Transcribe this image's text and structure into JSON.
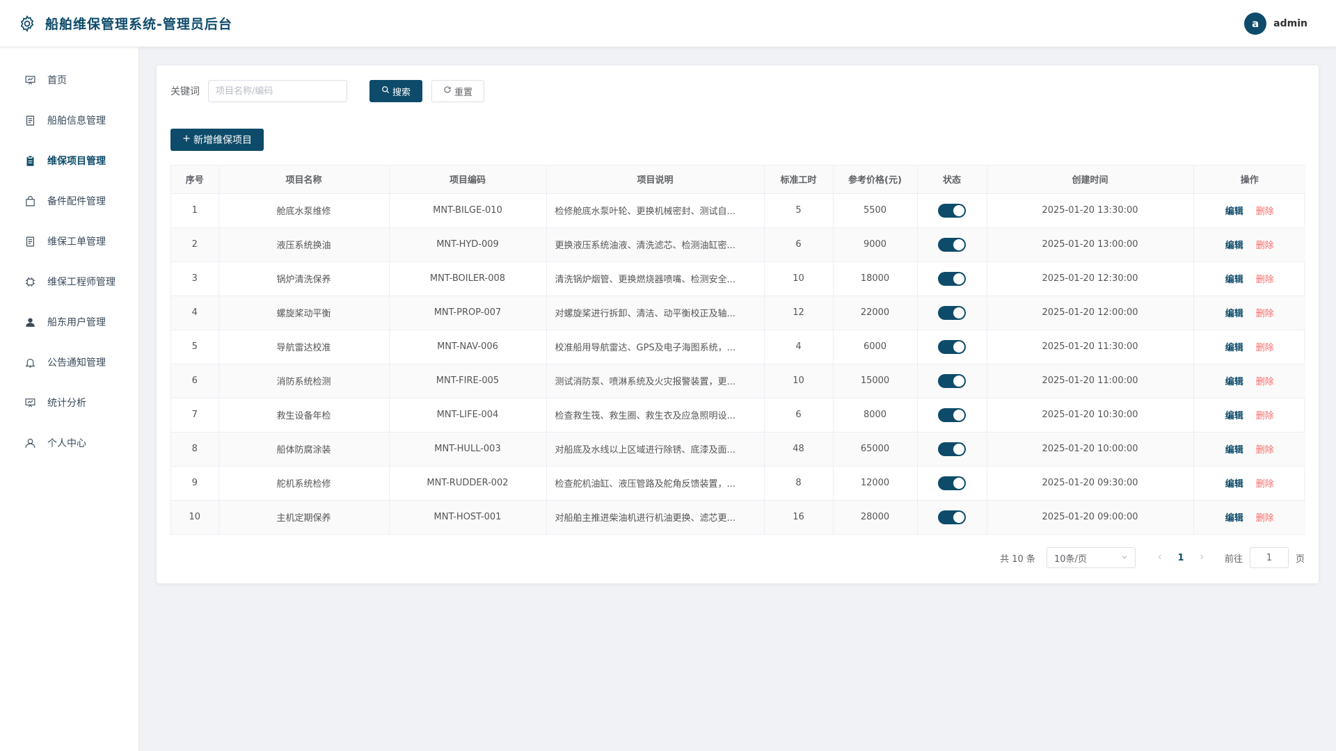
{
  "header": {
    "title": "船舶维保管理系统-管理员后台",
    "avatar_letter": "a",
    "username": "admin"
  },
  "sidebar": {
    "items": [
      {
        "label": "首页",
        "icon": "presentation-icon"
      },
      {
        "label": "船舶信息管理",
        "icon": "document-icon"
      },
      {
        "label": "维保项目管理",
        "icon": "clipboard-icon",
        "active": true
      },
      {
        "label": "备件配件管理",
        "icon": "bag-icon"
      },
      {
        "label": "维保工单管理",
        "icon": "document-icon"
      },
      {
        "label": "维保工程师管理",
        "icon": "cpu-icon"
      },
      {
        "label": "船东用户管理",
        "icon": "user-filled-icon"
      },
      {
        "label": "公告通知管理",
        "icon": "bell-icon"
      },
      {
        "label": "统计分析",
        "icon": "presentation-icon"
      },
      {
        "label": "个人中心",
        "icon": "user-icon"
      }
    ]
  },
  "search": {
    "label": "关键词",
    "placeholder": "项目名称/编码",
    "value": "",
    "search_label": "搜索",
    "reset_label": "重置"
  },
  "toolbar": {
    "add_label": "新增维保项目"
  },
  "table": {
    "columns": [
      "序号",
      "项目名称",
      "项目编码",
      "项目说明",
      "标准工时",
      "参考价格(元)",
      "状态",
      "创建时间",
      "操作"
    ],
    "edit_label": "编辑",
    "delete_label": "删除",
    "rows": [
      {
        "idx": "1",
        "name": "舱底水泵维修",
        "code": "MNT-BILGE-010",
        "desc": "检修舱底水泵叶轮、更换机械密封、测试自...",
        "hours": "5",
        "price": "5500",
        "enabled": true,
        "created": "2025-01-20 13:30:00"
      },
      {
        "idx": "2",
        "name": "液压系统换油",
        "code": "MNT-HYD-009",
        "desc": "更换液压系统油液、清洗滤芯、检测油缸密...",
        "hours": "6",
        "price": "9000",
        "enabled": true,
        "created": "2025-01-20 13:00:00"
      },
      {
        "idx": "3",
        "name": "锅炉清洗保养",
        "code": "MNT-BOILER-008",
        "desc": "清洗锅炉烟管、更换燃烧器喷嘴、检测安全...",
        "hours": "10",
        "price": "18000",
        "enabled": true,
        "created": "2025-01-20 12:30:00"
      },
      {
        "idx": "4",
        "name": "螺旋桨动平衡",
        "code": "MNT-PROP-007",
        "desc": "对螺旋桨进行拆卸、清洁、动平衡校正及轴...",
        "hours": "12",
        "price": "22000",
        "enabled": true,
        "created": "2025-01-20 12:00:00"
      },
      {
        "idx": "5",
        "name": "导航雷达校准",
        "code": "MNT-NAV-006",
        "desc": "校准船用导航雷达、GPS及电子海图系统，...",
        "hours": "4",
        "price": "6000",
        "enabled": true,
        "created": "2025-01-20 11:30:00"
      },
      {
        "idx": "6",
        "name": "消防系统检测",
        "code": "MNT-FIRE-005",
        "desc": "测试消防泵、喷淋系统及火灾报警装置，更...",
        "hours": "10",
        "price": "15000",
        "enabled": true,
        "created": "2025-01-20 11:00:00"
      },
      {
        "idx": "7",
        "name": "救生设备年检",
        "code": "MNT-LIFE-004",
        "desc": "检查救生筏、救生圈、救生衣及应急照明设...",
        "hours": "6",
        "price": "8000",
        "enabled": true,
        "created": "2025-01-20 10:30:00"
      },
      {
        "idx": "8",
        "name": "船体防腐涂装",
        "code": "MNT-HULL-003",
        "desc": "对船底及水线以上区域进行除锈、底漆及面...",
        "hours": "48",
        "price": "65000",
        "enabled": true,
        "created": "2025-01-20 10:00:00"
      },
      {
        "idx": "9",
        "name": "舵机系统检修",
        "code": "MNT-RUDDER-002",
        "desc": "检查舵机油缸、液压管路及舵角反馈装置，...",
        "hours": "8",
        "price": "12000",
        "enabled": true,
        "created": "2025-01-20 09:30:00"
      },
      {
        "idx": "10",
        "name": "主机定期保养",
        "code": "MNT-HOST-001",
        "desc": "对船舶主推进柴油机进行机油更换、滤芯更...",
        "hours": "16",
        "price": "28000",
        "enabled": true,
        "created": "2025-01-20 09:00:00"
      }
    ]
  },
  "pagination": {
    "total_text": "共 10 条",
    "page_size": "10条/页",
    "current_page": "1",
    "goto_label": "前往",
    "goto_value": "1",
    "page_suffix": "页"
  },
  "colors": {
    "primary": "#0e4b6a",
    "danger": "#f56c6c"
  }
}
